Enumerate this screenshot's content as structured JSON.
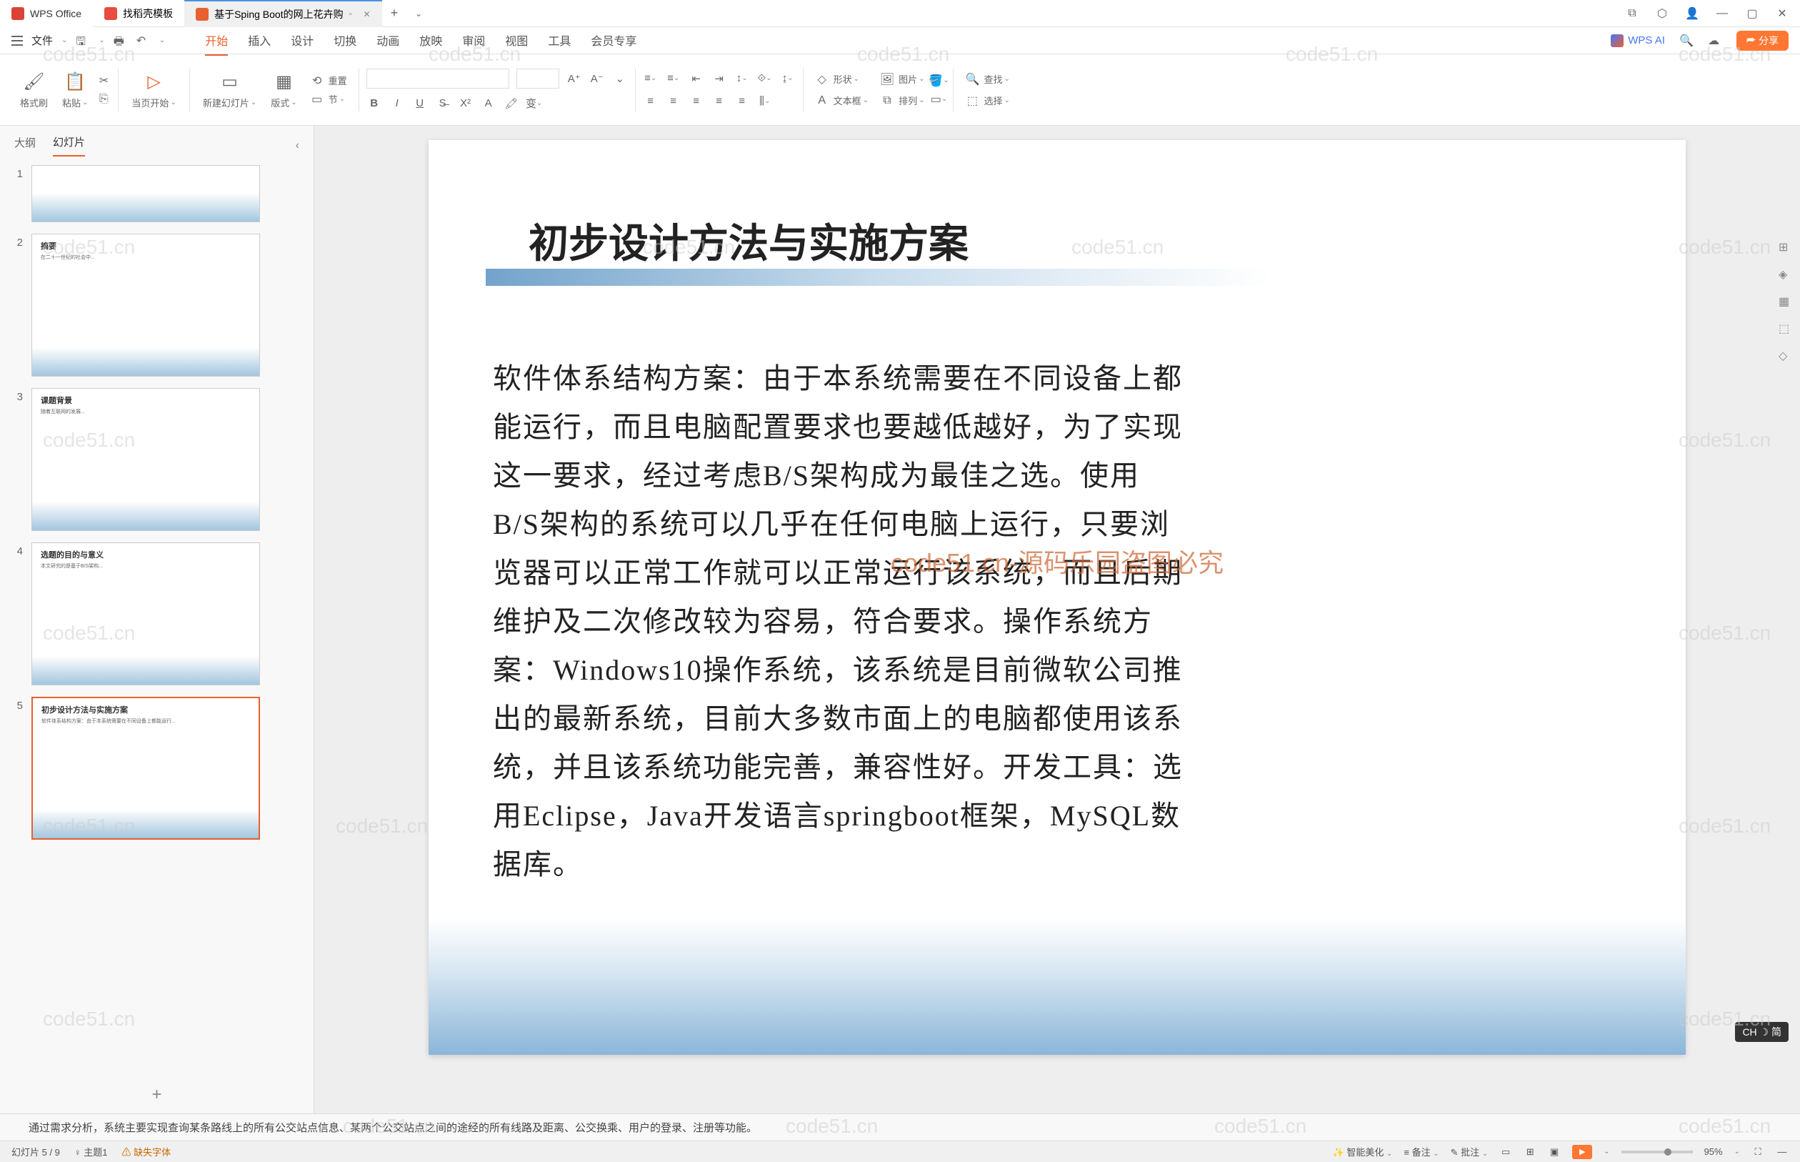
{
  "titlebar": {
    "app_name": "WPS Office",
    "tab_docer": "找稻壳模板",
    "tab_active": "基于Sping Boot的网上花卉购",
    "add": "+"
  },
  "menubar": {
    "file": "文件",
    "tabs": [
      "开始",
      "插入",
      "设计",
      "切换",
      "动画",
      "放映",
      "审阅",
      "视图",
      "工具",
      "会员专享"
    ],
    "active_tab": "开始",
    "wps_ai": "WPS AI",
    "share": "分享"
  },
  "ribbon": {
    "format_painter": "格式刷",
    "paste": "粘贴",
    "from_current": "当页开始",
    "new_slide": "新建幻灯片",
    "layout": "版式",
    "section": "节",
    "reset": "重置",
    "shape": "形状",
    "picture": "图片",
    "textbox": "文本框",
    "arrange": "排列",
    "find": "查找",
    "select": "选择"
  },
  "sidebar": {
    "tab_outline": "大纲",
    "tab_slides": "幻灯片",
    "thumbs": [
      {
        "num": "1",
        "title": ""
      },
      {
        "num": "2",
        "title": "摘要"
      },
      {
        "num": "3",
        "title": "课题背景"
      },
      {
        "num": "4",
        "title": "选题的目的与意义"
      },
      {
        "num": "5",
        "title": "初步设计方法与实施方案"
      }
    ]
  },
  "slide": {
    "title": "初步设计方法与实施方案",
    "body": "软件体系结构方案：由于本系统需要在不同设备上都能运行，而且电脑配置要求也要越低越好，为了实现这一要求，经过考虑B/S架构成为最佳之选。使用B/S架构的系统可以几乎在任何电脑上运行，只要浏览器可以正常工作就可以正常运行该系统，而且后期维护及二次修改较为容易，符合要求。操作系统方案：Windows10操作系统，该系统是目前微软公司推出的最新系统，目前大多数市面上的电脑都使用该系统，并且该系统功能完善，兼容性好。开发工具：选用Eclipse，Java开发语言springboot框架，MySQL数据库。",
    "center_watermark": "code51.cn-源码乐园盗图必究"
  },
  "notes": "通过需求分析，系统主要实现查询某条路线上的所有公交站点信息、某两个公交站点之间的途经的所有线路及距离、公交换乘、用户的登录、注册等功能。",
  "statusbar": {
    "slide_info": "幻灯片 5 / 9",
    "theme": "主题1",
    "missing_font": "缺失字体",
    "smart_beautify": "智能美化",
    "notes_btn": "备注",
    "review_btn": "批注",
    "zoom": "95%"
  },
  "ime": "CH ☽ 简",
  "watermark_text": "code51.cn"
}
